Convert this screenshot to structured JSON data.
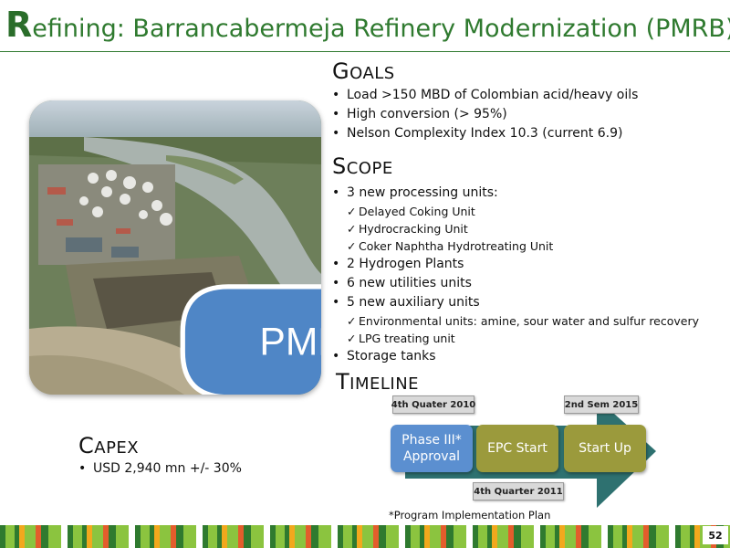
{
  "title": {
    "first_letter": "R",
    "rest": "efining: Barrancabermeja Refinery Modernization (PMRB)"
  },
  "photo": {
    "callout_label": "PMRB"
  },
  "goals": {
    "heading_cap": "G",
    "heading_rest": "OALS",
    "items": [
      "Load  >150 MBD of Colombian acid/heavy oils",
      "High conversion (> 95%)",
      "Nelson Complexity Index 10.3 (current 6.9)"
    ]
  },
  "scope": {
    "heading_cap": "S",
    "heading_rest": "COPE",
    "items": [
      {
        "text": "3 new processing units:",
        "sub": [
          "Delayed Coking Unit",
          "Hydrocracking Unit",
          "Coker Naphtha Hydrotreating Unit"
        ]
      },
      {
        "text": "2 Hydrogen Plants",
        "sub": []
      },
      {
        "text": "6 new utilities units",
        "sub": []
      },
      {
        "text": "5 new auxiliary units",
        "sub": [
          "Environmental units: amine, sour water and sulfur recovery",
          "LPG treating unit"
        ]
      },
      {
        "text": "Storage tanks",
        "sub": []
      }
    ]
  },
  "timeline": {
    "heading_cap": "T",
    "heading_rest": "IMELINE",
    "phases": [
      {
        "label": "Phase III* Approval",
        "color": "#5b8fd0"
      },
      {
        "label": "EPC Start",
        "color": "#9b9a3c"
      },
      {
        "label": "Start Up",
        "color": "#9b9a3c"
      }
    ],
    "tags": {
      "top_left": "4th Quater 2010",
      "top_right": "2nd Sem 2015",
      "bottom": "4th Quarter 2011"
    },
    "arrow_color": "#2e7170"
  },
  "capex": {
    "heading_cap": "C",
    "heading_rest": "APEX",
    "items": [
      "USD 2,940 mn +/- 30%"
    ]
  },
  "footnote": "*Program Implementation Plan",
  "page_number": "52",
  "colors": {
    "title_green": "#2f7a2f",
    "strip": [
      "#2f7a2f",
      "#8bc43f",
      "#f2a81d",
      "#e35d2c",
      "#ffffff"
    ]
  }
}
